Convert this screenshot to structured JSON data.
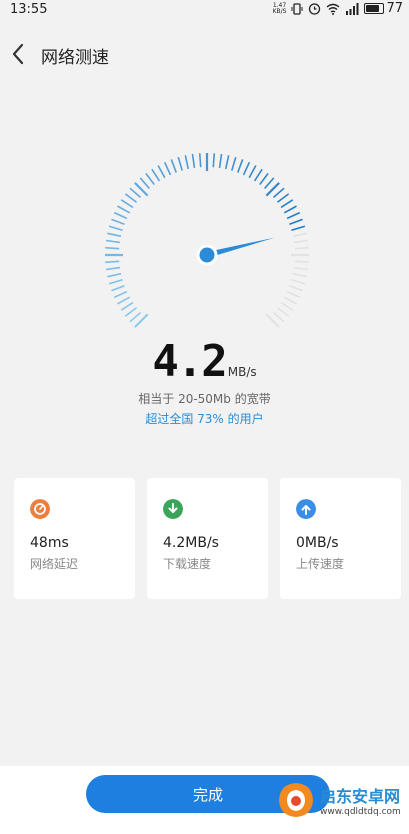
{
  "status_bar": {
    "time": "13:55",
    "net_speed_value": "1.47",
    "net_speed_unit": "KB/S",
    "battery_level": "77",
    "icons": [
      "vibrate-icon",
      "alarm-icon",
      "wifi-icon",
      "signal-icon",
      "battery-icon"
    ]
  },
  "header": {
    "back_icon": "chevron-left-icon",
    "title": "网络测速"
  },
  "gauge": {
    "needle_fraction": 0.78,
    "accent_color": "#2b8bd6"
  },
  "result": {
    "speed_value": "4.2",
    "speed_unit": "MB/s",
    "bandwidth_text": "相当于 20-50Mb 的宽带",
    "rank_text": "超过全国 73% 的用户"
  },
  "cards": [
    {
      "icon": "latency-icon",
      "color": "#ef7d3c",
      "value": "48ms",
      "label": "网络延迟"
    },
    {
      "icon": "download-icon",
      "color": "#3aa559",
      "value": "4.2MB/s",
      "label": "下载速度"
    },
    {
      "icon": "upload-icon",
      "color": "#3b8ee6",
      "value": "0MB/s",
      "label": "上传速度"
    }
  ],
  "footer": {
    "done_label": "完成"
  },
  "watermark": {
    "name": "启东安卓网",
    "url": "www.qdldtdq.com"
  }
}
